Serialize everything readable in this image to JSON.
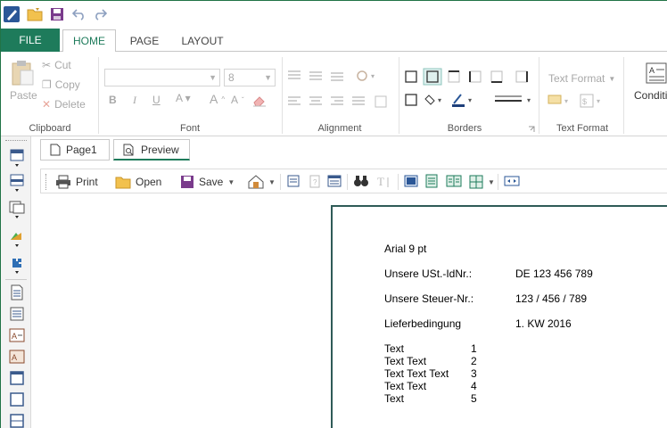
{
  "app": {
    "tabs": {
      "file": "FILE",
      "home": "HOME",
      "page": "PAGE",
      "layout": "LAYOUT"
    }
  },
  "ribbon": {
    "clipboard": {
      "paste": "Paste",
      "cut": "Cut",
      "copy": "Copy",
      "delete": "Delete",
      "label": "Clipboard"
    },
    "font": {
      "font_name": "",
      "font_size": "8",
      "label": "Font"
    },
    "alignment": {
      "label": "Alignment"
    },
    "borders": {
      "label": "Borders"
    },
    "text_format": {
      "button": "Text Format",
      "label": "Text Format"
    },
    "conditional": {
      "label": "Conditi"
    }
  },
  "doc_tabs": {
    "page1": "Page1",
    "preview": "Preview"
  },
  "preview_toolbar": {
    "print": "Print",
    "open": "Open",
    "save": "Save"
  },
  "page_content": {
    "font_line": "Arial 9 pt",
    "rows": [
      {
        "label": "Unsere USt.-IdNr.:",
        "value": "DE 123 456 789"
      },
      {
        "label": "Unsere Steuer-Nr.:",
        "value": "123 / 456 / 789"
      },
      {
        "label": "Lieferbedingung",
        "value": "1. KW 2016"
      }
    ],
    "list": [
      {
        "text": "Text",
        "num": "1"
      },
      {
        "text": "Text Text",
        "num": "2"
      },
      {
        "text": "Text Text Text",
        "num": "3"
      },
      {
        "text": "Text Text",
        "num": "4"
      },
      {
        "text": "Text",
        "num": "5"
      }
    ]
  },
  "colors": {
    "accent": "#1e7b5b",
    "page_border": "#2f5b57"
  }
}
